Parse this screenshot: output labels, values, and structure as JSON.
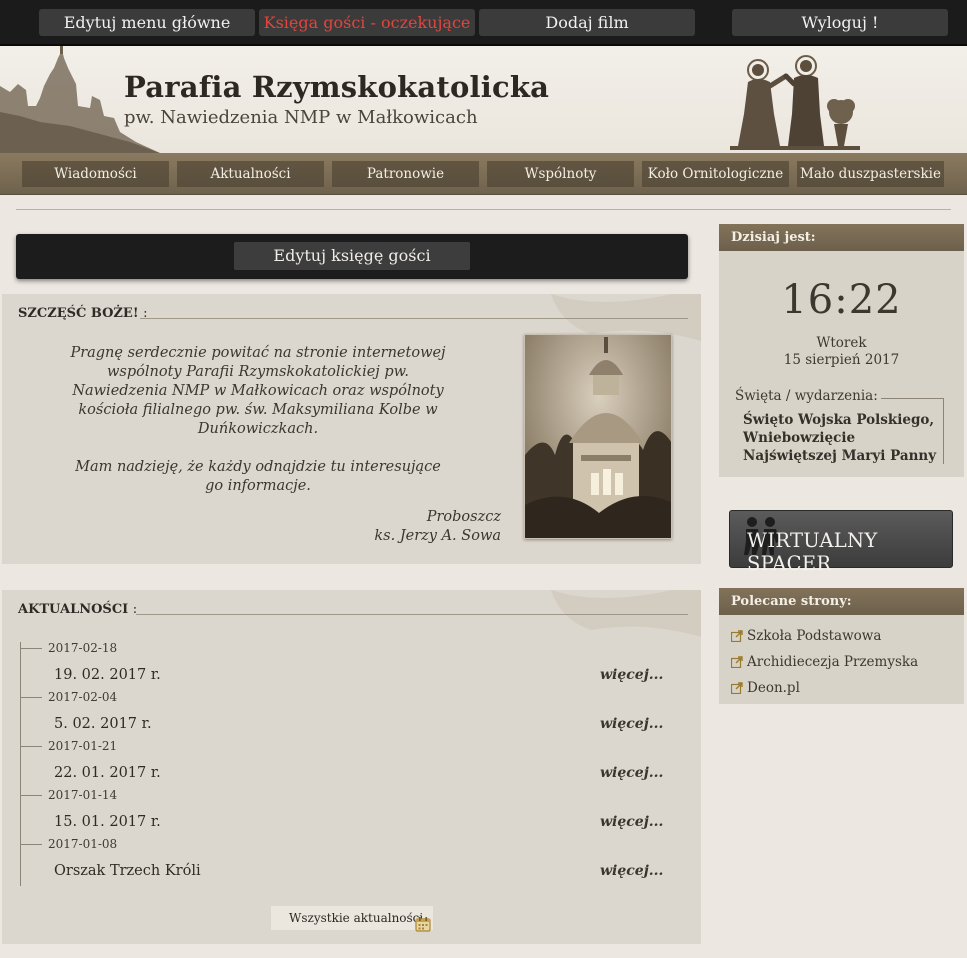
{
  "admin_bar": {
    "items": [
      {
        "label": "Edytuj menu główne"
      },
      {
        "label": "Księga gości - oczekujące"
      },
      {
        "label": "Dodaj film"
      },
      {
        "label": "Wyloguj !"
      }
    ],
    "alert_color": "#e0463e"
  },
  "header": {
    "title": "Parafia Rzymskokatolicka",
    "subtitle": "pw. Nawiedzenia NMP w Małkowicach"
  },
  "nav": {
    "items": [
      {
        "label": "Wiadomości"
      },
      {
        "label": "Aktualności"
      },
      {
        "label": "Patronowie"
      },
      {
        "label": "Wspólnoty"
      },
      {
        "label": "Koło Ornitologiczne"
      },
      {
        "label": "Mało duszpasterskie"
      }
    ]
  },
  "guestbook": {
    "edit_label": "Edytuj księgę gości"
  },
  "welcome": {
    "heading": "SZCZĘŚĆ BOŻE!",
    "heading_suffix": ":",
    "paragraph1": "Pragnę serdecznie powitać na stronie internetowej wspólnoty Parafii Rzymskokatolickiej pw. Nawiedzenia NMP w Małkowicach oraz wspólnoty kościoła filialnego pw. św. Maksymiliana Kolbe w Duńkowiczkach.",
    "paragraph2": "Mam nadzieję, że każdy odnajdzie tu interesujące go informacje.",
    "signature_role": "Proboszcz",
    "signature_name": "ks. Jerzy A. Sowa"
  },
  "news": {
    "heading": "AKTUALNOŚCI",
    "heading_suffix": ":",
    "items": [
      {
        "date": "2017-02-18",
        "title": "19. 02. 2017 r.",
        "more": "więcej..."
      },
      {
        "date": "2017-02-04",
        "title": "5. 02. 2017 r.",
        "more": "więcej..."
      },
      {
        "date": "2017-01-21",
        "title": "22. 01. 2017 r.",
        "more": "więcej..."
      },
      {
        "date": "2017-01-14",
        "title": "15. 01. 2017 r.",
        "more": "więcej..."
      },
      {
        "date": "2017-01-08",
        "title": "Orszak Trzech Króli",
        "more": "więcej..."
      }
    ],
    "all_label": "Wszystkie aktualności"
  },
  "sidebar": {
    "today_heading": "Dzisiaj jest:",
    "time": "16:22",
    "weekday": "Wtorek",
    "date": "15 sierpień 2017",
    "holidays_label": "Święta / wydarzenia:",
    "holidays_text": "Święto Wojska Polskiego, Wniebowzięcie Najświętszej Maryi Panny",
    "virtual_tour_label": "WIRTUALNY SPACER",
    "links_heading": "Polecane strony:",
    "links": [
      {
        "label": "Szkoła Podstawowa"
      },
      {
        "label": "Archidiecezja Przemyska"
      },
      {
        "label": "Deon.pl"
      }
    ]
  },
  "colors": {
    "admin_bg": "#1b1b1b",
    "nav_bg": "#7d6f58",
    "panel_bg": "#dcd7ce",
    "page_bg": "#ece8e1"
  }
}
